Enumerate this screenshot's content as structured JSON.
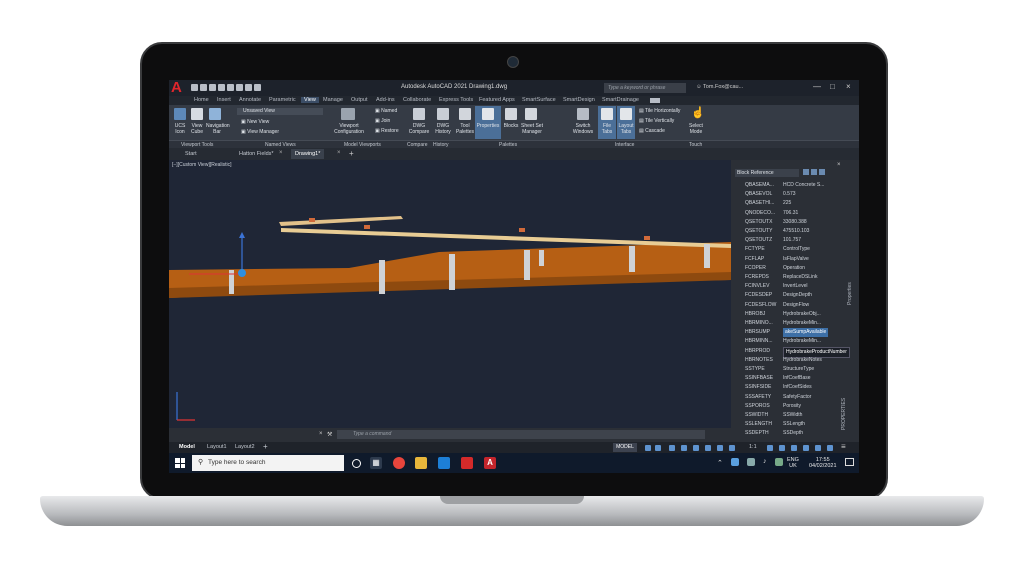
{
  "app": {
    "title": "Autodesk AutoCAD 2021   Drawing1.dwg",
    "search_placeholder": "Type a keyword or phrase",
    "user": "Tom.Fox@cau...",
    "logo_letter": "A"
  },
  "ribbon_tabs": [
    "Home",
    "Insert",
    "Annotate",
    "Parametric",
    "View",
    "Manage",
    "Output",
    "Add-ins",
    "Collaborate",
    "Express Tools",
    "Featured Apps",
    "SmartSurface",
    "SmartDesign",
    "SmartDrainage"
  ],
  "active_ribbon_tab": "View",
  "ribbon": {
    "viewport_tools": {
      "ucs_icon": "UCS\nIcon",
      "view_cube": "View\nCube",
      "navigation_bar": "Navigation\nBar",
      "label": "Viewport Tools"
    },
    "named_views": {
      "dropdown": "Unsaved View",
      "new_view": "New View",
      "view_manager": "View Manager",
      "label": "Named Views"
    },
    "model_viewports": {
      "configuration": "Viewport\nConfiguration",
      "named": "Named",
      "join": "Join",
      "restore": "Restore",
      "label": "Model Viewports"
    },
    "compare": {
      "dwg_compare": "DWG\nCompare",
      "label": "Compare"
    },
    "history": {
      "dwg_history": "DWG\nHistory",
      "label": "History"
    },
    "palettes": {
      "tool_palettes": "Tool\nPalettes",
      "properties": "Properties",
      "blocks": "Blocks",
      "sheet_set_manager": "Sheet Set\nManager",
      "label": "Palettes"
    },
    "interface": {
      "switch_windows": "Switch\nWindows",
      "file_tabs": "File\nTabs",
      "layout_tabs": "Layout\nTabs",
      "tile_horizontally": "Tile Horizontally",
      "tile_vertically": "Tile Vertically",
      "cascade": "Cascade",
      "label": "Interface"
    },
    "touch": {
      "select_mode": "Select\nMode",
      "label": "Touch"
    }
  },
  "doc_tabs": [
    "Start",
    "Hatton Fields*",
    "Drawing1*"
  ],
  "active_doc_tab": "Drawing1*",
  "viewport_label": "[−][Custom View][Realistic]",
  "properties": {
    "selector": "Block Reference",
    "side_label": "Properties",
    "side_label2": "PROPERTIES",
    "rows": [
      {
        "k": "QBASEMA...",
        "v": "HCD Concrete S..."
      },
      {
        "k": "QBASEVOL",
        "v": "0.573"
      },
      {
        "k": "QBASETHI...",
        "v": "225"
      },
      {
        "k": "QNODECO...",
        "v": "706.31"
      },
      {
        "k": "QSETOUTX",
        "v": "33080.388"
      },
      {
        "k": "QSETOUTY",
        "v": "475510.103"
      },
      {
        "k": "QSETOUTZ",
        "v": "101.757"
      },
      {
        "k": "FCTYPE",
        "v": "ControlType"
      },
      {
        "k": "FCFLAP",
        "v": "IsFlapValve"
      },
      {
        "k": "FCOPER",
        "v": "Operation"
      },
      {
        "k": "FCREPDS",
        "v": "ReplaceDSLink"
      },
      {
        "k": "FCINVLEV",
        "v": "InvertLevel"
      },
      {
        "k": "FCDESDEP",
        "v": "DesignDepth"
      },
      {
        "k": "FCDESFLOW",
        "v": "DesignFlow"
      },
      {
        "k": "HBROBJ",
        "v": "HydrobrakeObj..."
      },
      {
        "k": "HBRMINO...",
        "v": "HydrobrakeMin..."
      },
      {
        "k": "HBRSUMP",
        "v": "akeSumpAvailable"
      },
      {
        "k": "HBRMINN...",
        "v": "HydrobrakeMin..."
      },
      {
        "k": "HBRPROD",
        "v": "HydrobrakeProductNumber"
      },
      {
        "k": "HBRNOTES",
        "v": "HydrobrakeNotes"
      },
      {
        "k": "SSTYPE",
        "v": "StructureType"
      },
      {
        "k": "SSINFBASE",
        "v": "InfCoefBase"
      },
      {
        "k": "SSINFSIDE",
        "v": "InfCoefSides"
      },
      {
        "k": "SSSAFETY",
        "v": "SafetyFactor"
      },
      {
        "k": "SSPOROS",
        "v": "Porosity"
      },
      {
        "k": "SSWIDTH",
        "v": "SSWidth"
      },
      {
        "k": "SSLENGTH",
        "v": "SSLength"
      },
      {
        "k": "SSDEPTH",
        "v": "SSDepth"
      }
    ]
  },
  "command_placeholder": "Type a command",
  "layout_tabs": [
    "Model",
    "Layout1",
    "Layout2"
  ],
  "active_layout_tab": "Model",
  "status": {
    "model": "MODEL",
    "scale": "1:1"
  },
  "taskbar": {
    "search_placeholder": "Type here to search",
    "lang": "ENG",
    "region": "UK",
    "time": "17:55",
    "date": "04/02/2021"
  }
}
